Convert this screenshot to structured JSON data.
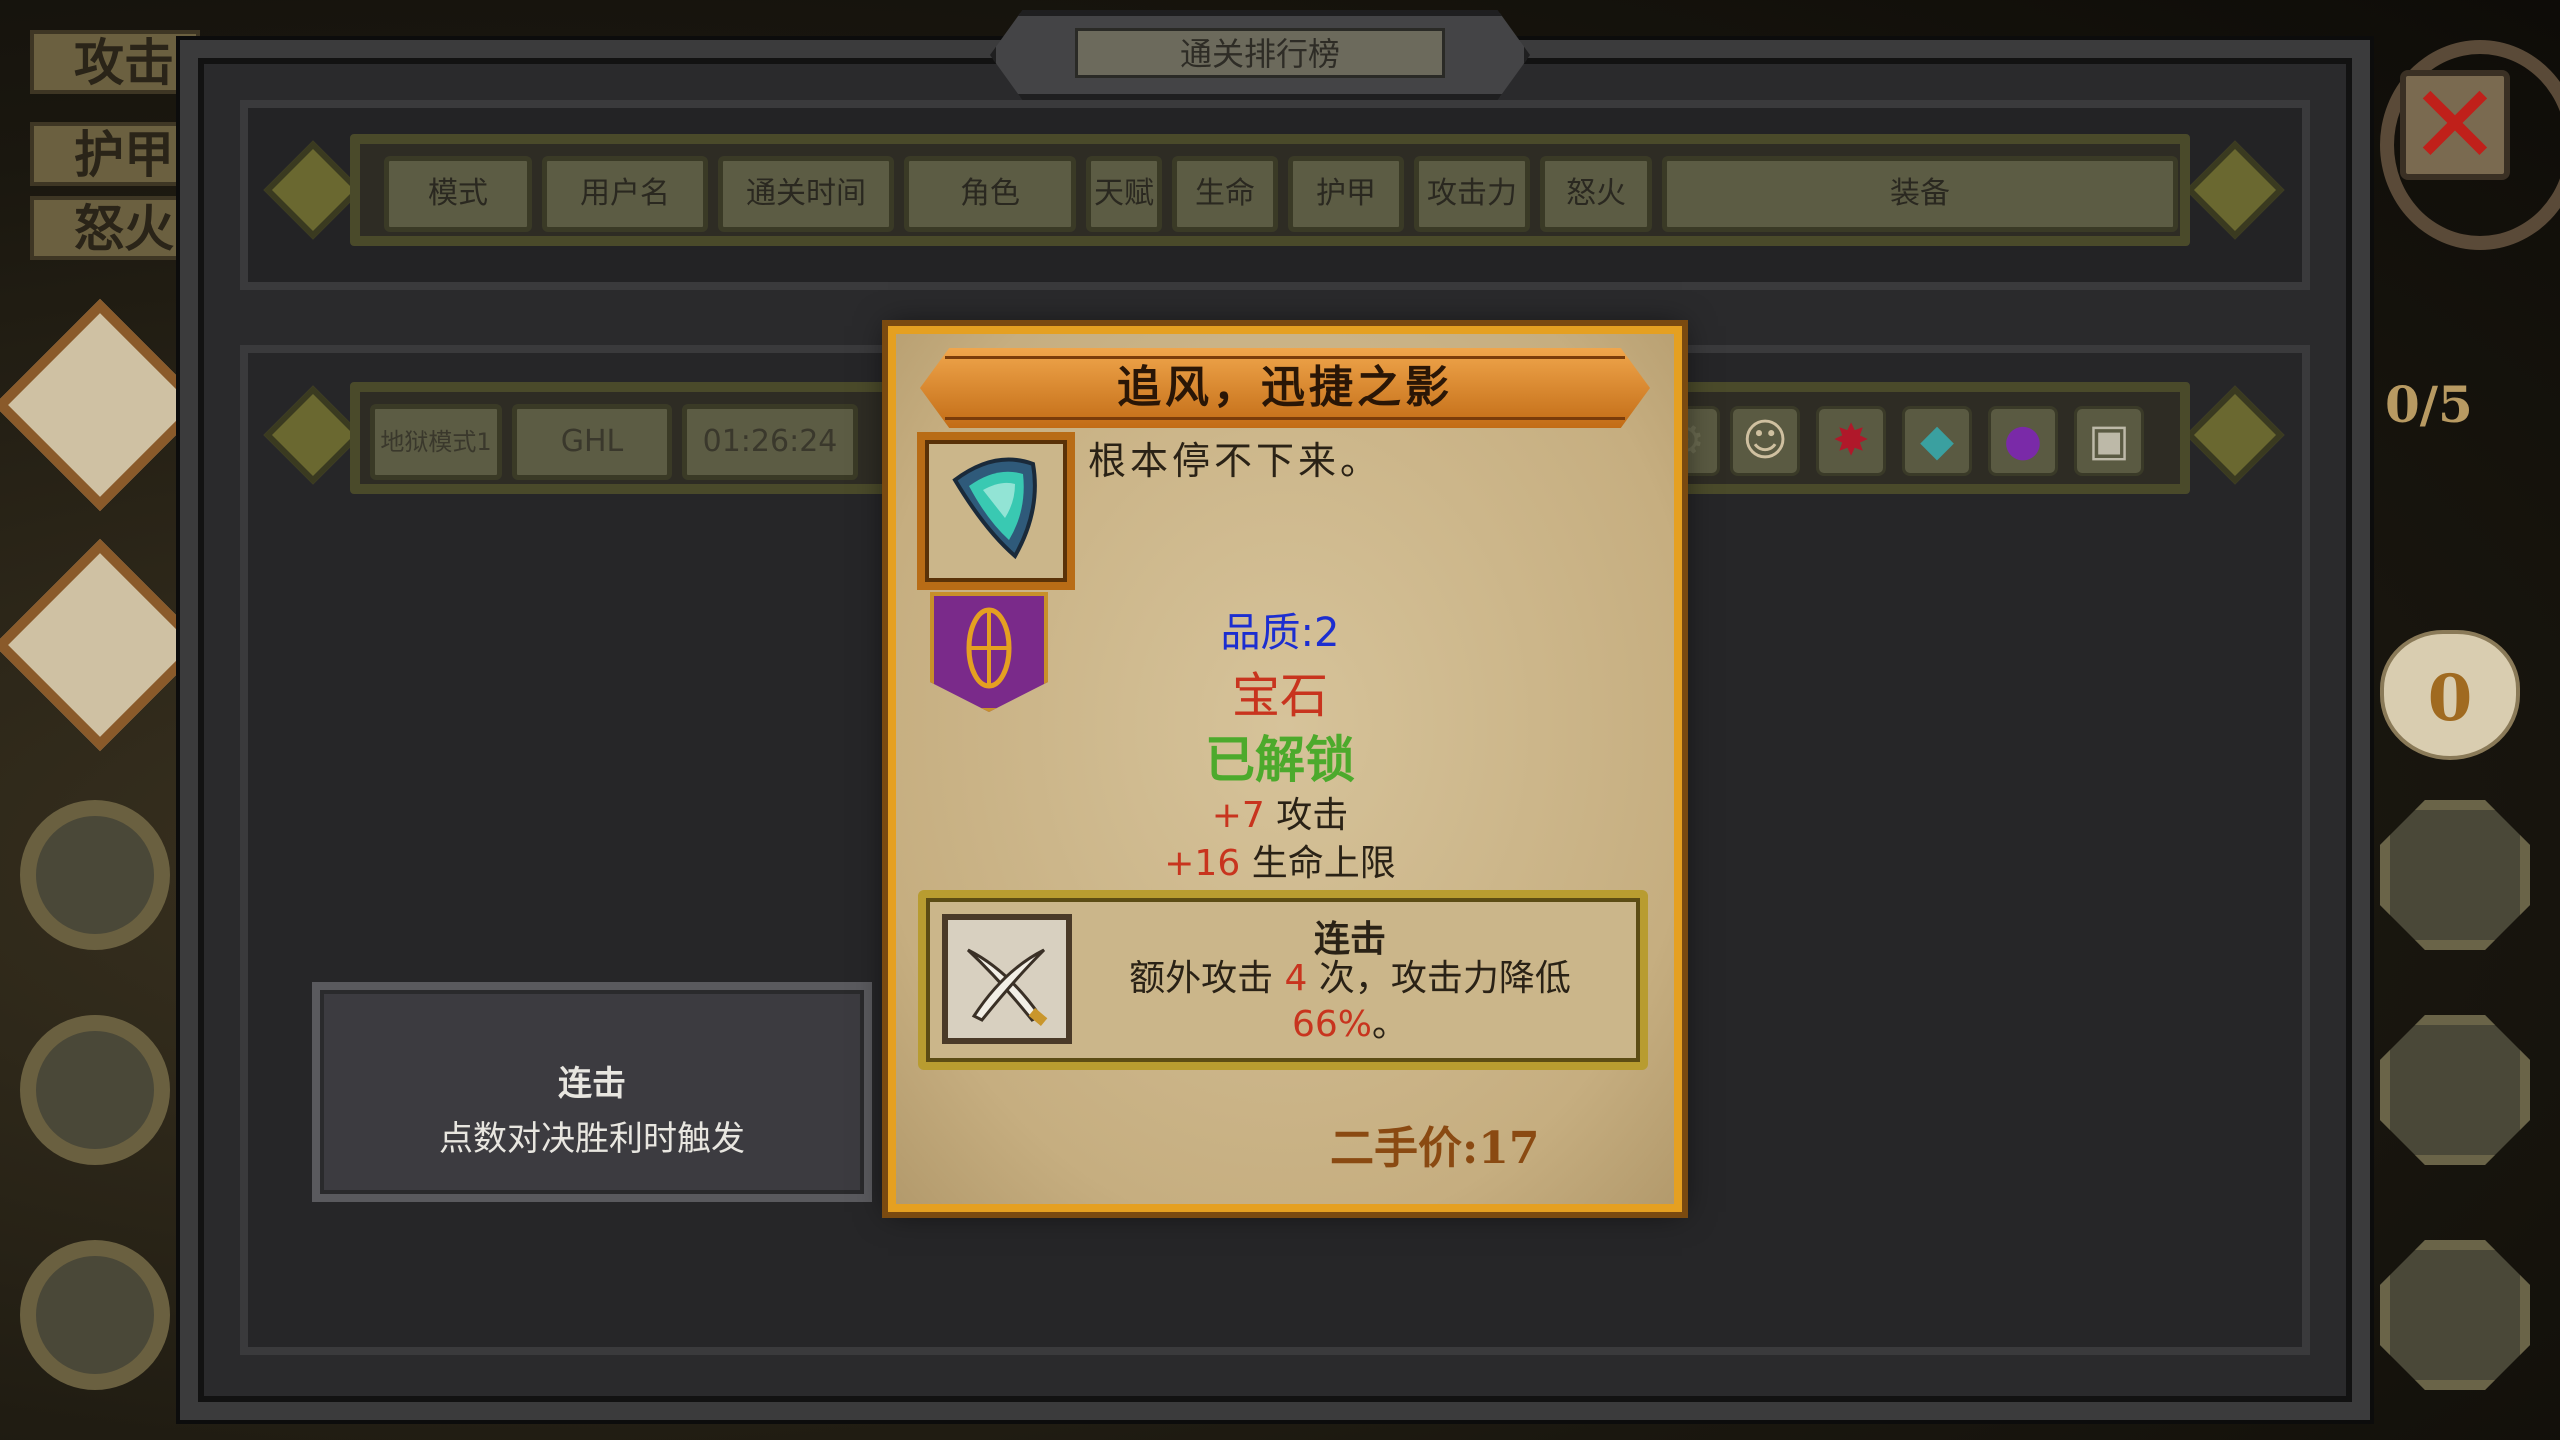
{
  "background": {
    "left_stats": [
      "攻击",
      "护甲",
      "怒火"
    ],
    "counter": "0/5",
    "coins": "0"
  },
  "window": {
    "title": "通关排行榜",
    "columns": [
      "模式",
      "用户名",
      "通关时间",
      "角色",
      "天赋",
      "生命",
      "护甲",
      "攻击力",
      "怒火",
      "装备"
    ],
    "row": {
      "mode": "地狱模式1",
      "username": "GHL",
      "time": "01:26:24",
      "equipment_icons": [
        "gear-icon",
        "face-icon",
        "red-spiky-gem-icon",
        "teal-gem-icon",
        "purple-orb-icon",
        "cube-icon"
      ]
    }
  },
  "trigger_tooltip": {
    "name": "连击",
    "condition": "点数对决胜利时触发"
  },
  "item_tooltip": {
    "name": "追风，迅捷之影",
    "description": "根本停不下来。",
    "quality": "品质:2",
    "type": "宝石",
    "status": "已解锁",
    "stats": [
      {
        "value": "+7",
        "label": "攻击"
      },
      {
        "value": "+16",
        "label": "生命上限"
      }
    ],
    "skill": {
      "name": "连击",
      "desc_prefix": "额外攻击",
      "count": "4",
      "desc_middle": "次，攻击力降低",
      "percent": "66%",
      "desc_suffix": "。"
    },
    "price": "二手价:17"
  },
  "colors": {
    "tooltip_border": "#e5a021",
    "quality_blue": "#1c2ed0",
    "value_red": "#c8341e",
    "unlock_green": "#4caa2c"
  }
}
